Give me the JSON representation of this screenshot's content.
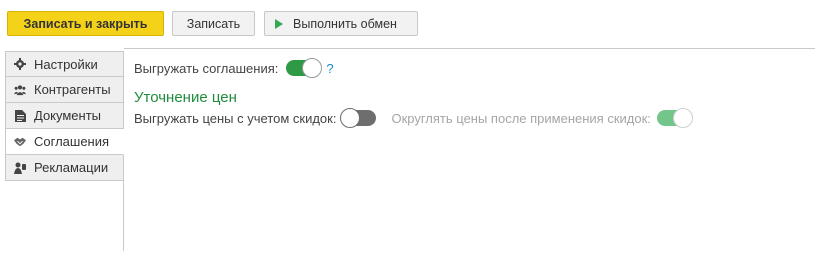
{
  "toolbar": {
    "save_close_label": "Записать и закрыть",
    "save_label": "Записать",
    "exchange_label": "Выполнить обмен"
  },
  "tabs": [
    {
      "label": "Настройки",
      "icon": "gear-icon"
    },
    {
      "label": "Контрагенты",
      "icon": "people-icon"
    },
    {
      "label": "Документы",
      "icon": "document-icon"
    },
    {
      "label": "Соглашения",
      "icon": "handshake-icon",
      "active": true
    },
    {
      "label": "Рекламации",
      "icon": "complaint-icon"
    }
  ],
  "agreements": {
    "export_label": "Выгружать соглашения:",
    "export_on": true,
    "help": "?"
  },
  "price_section": {
    "title": "Уточнение цен",
    "discount_label": "Выгружать цены с учетом скидок:",
    "discount_on": false,
    "round_label": "Округлять цены после применения скидок:",
    "round_on": true,
    "round_disabled": true
  },
  "colors": {
    "accent_yellow": "#f5d21a",
    "toggle_green": "#2e9a45",
    "section_green": "#1f8c3b",
    "help_blue": "#1a86d0"
  }
}
